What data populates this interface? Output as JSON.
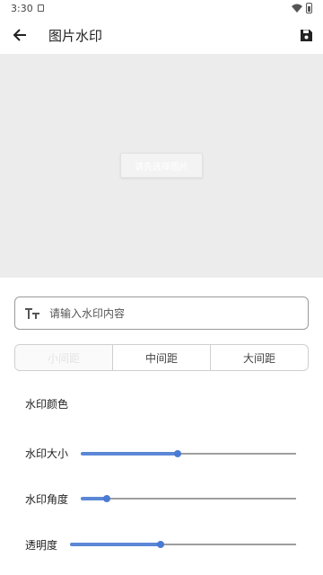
{
  "status": {
    "time": "3:30"
  },
  "app_bar": {
    "title": "图片水印"
  },
  "preview": {
    "select_button_label": "请先选择图片"
  },
  "watermark_input": {
    "placeholder": "请输入水印内容",
    "value": ""
  },
  "spacing": {
    "options": [
      "小间距",
      "中间距",
      "大间距"
    ],
    "selected": "小间距"
  },
  "settings": {
    "color_label": "水印颜色",
    "size_label": "水印大小",
    "angle_label": "水印角度",
    "opacity_label": "透明度"
  },
  "sliders": {
    "size": 0.45,
    "angle": 0.12,
    "opacity": 0.4
  },
  "colors": {
    "accent": "#4a7bd4",
    "preview_bg": "#ececec"
  }
}
